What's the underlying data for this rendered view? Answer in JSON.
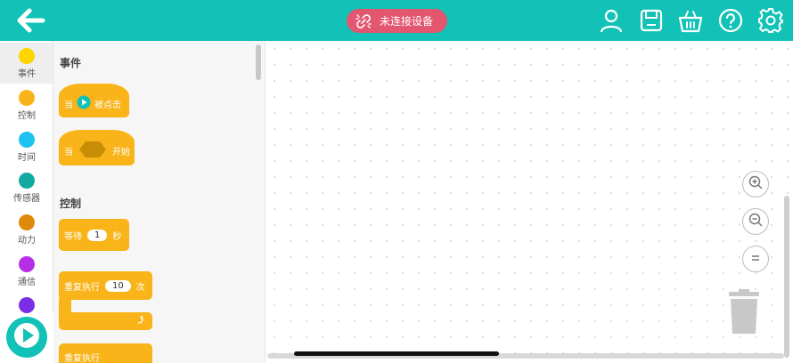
{
  "header": {
    "connection_label": "未连接设备",
    "icons": [
      "back-arrow-icon",
      "user-icon",
      "save-icon",
      "basket-icon",
      "help-icon",
      "settings-icon"
    ]
  },
  "categories": [
    {
      "label": "事件",
      "color": "#ffd500"
    },
    {
      "label": "控制",
      "color": "#f8b418"
    },
    {
      "label": "时间",
      "color": "#1cc2f0"
    },
    {
      "label": "传感器",
      "color": "#12aaa0"
    },
    {
      "label": "动力",
      "color": "#e08a0b"
    },
    {
      "label": "通信",
      "color": "#b62fe6"
    },
    {
      "label": "",
      "color": "#7b2ee6"
    }
  ],
  "palette": {
    "events_title": "事件",
    "when_label": "当",
    "clicked_label": "被点击",
    "start_label": "开始",
    "control_title": "控制",
    "wait_label": "等待",
    "wait_value": "1",
    "wait_unit": "秒",
    "repeat_label": "重复执行",
    "repeat_value": "10",
    "repeat_unit": "次",
    "forever_label": "重复执行"
  },
  "colors": {
    "header": "#12c2b6",
    "block": "#f8b418",
    "disconnected": "#e2566f"
  }
}
